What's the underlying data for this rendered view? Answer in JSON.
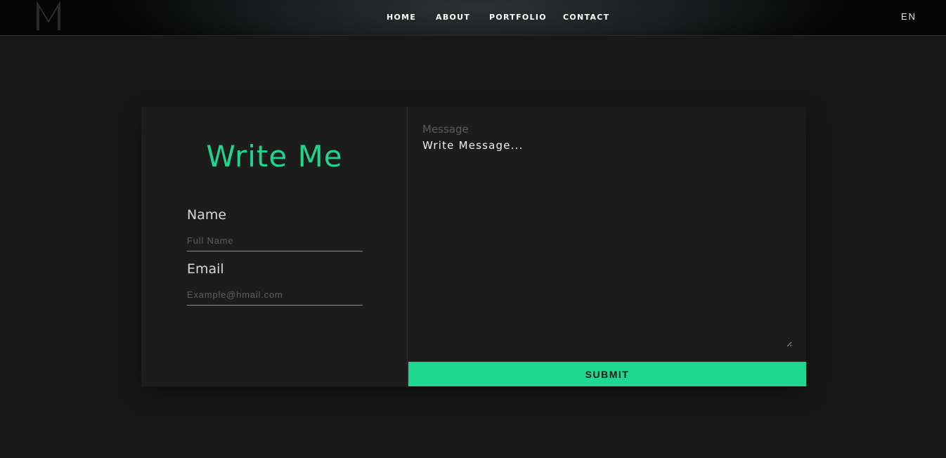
{
  "header": {
    "nav": [
      {
        "label": "HOME"
      },
      {
        "label": "ABOUT"
      },
      {
        "label": "PORTFOLIO"
      },
      {
        "label": "CONTACT"
      }
    ],
    "language": "EN",
    "logo_icon": "m-monogram-icon"
  },
  "form": {
    "title": "Write Me",
    "name": {
      "label": "Name",
      "placeholder": "Full Name",
      "value": ""
    },
    "email": {
      "label": "Email",
      "placeholder": "Example@hmail.com",
      "value": ""
    },
    "message": {
      "label": "Message",
      "placeholder": "Write Message...",
      "value": ""
    },
    "submit_label": "SUBMIT"
  },
  "colors": {
    "accent": "#1fd88f",
    "background": "#181818",
    "card": "#1c1c1c"
  }
}
